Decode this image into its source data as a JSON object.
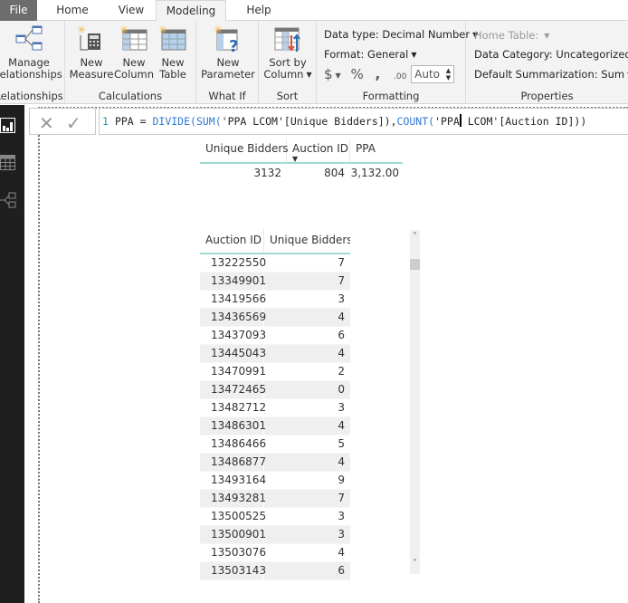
{
  "tabs": {
    "file": "File",
    "home": "Home",
    "view": "View",
    "modeling": "Modeling",
    "help": "Help"
  },
  "ribbon": {
    "relationships": {
      "manage_label_1": "Manage",
      "manage_label_2": "relationships",
      "group_label": "Relationships"
    },
    "calculations": {
      "new_measure_1": "New",
      "new_measure_2": "Measure",
      "new_column_1": "New",
      "new_column_2": "Column",
      "new_table_1": "New",
      "new_table_2": "Table",
      "group_label": "Calculations"
    },
    "whatif": {
      "new_parameter_1": "New",
      "new_parameter_2": "Parameter",
      "group_label": "What If"
    },
    "sort": {
      "sort_by_1": "Sort by",
      "sort_by_2": "Column",
      "group_label": "Sort"
    },
    "formatting": {
      "data_type": "Data type: Decimal Number",
      "format": "Format: General",
      "currency_symbol": "$",
      "percent_symbol": "%",
      "comma_symbol": ",",
      "decimal_symbol": ".00",
      "decimal_places": "Auto",
      "group_label": "Formatting"
    },
    "properties": {
      "home_table": "Home Table:",
      "data_category": "Data Category: Uncategorized",
      "default_summarization": "Default Summarization: Sum",
      "group_label": "Properties"
    }
  },
  "formula_bar": {
    "line_number": "1",
    "part1": "PPA = ",
    "fn_divide": "DIVIDE(",
    "fn_sum": "SUM(",
    "part2": "'PPA LCOM'[Unique Bidders]),",
    "fn_count": "COUNT(",
    "part3": "'PPA",
    "part4": " LCOM'[Auction ID]))"
  },
  "summary_table": {
    "headers": [
      "Unique Bidders",
      "Auction ID",
      "PPA"
    ],
    "row": [
      "3132",
      "804",
      "3,132.00"
    ]
  },
  "detail_table": {
    "headers": [
      "Auction ID",
      "Unique Bidders"
    ],
    "rows": [
      [
        "13222550",
        "7"
      ],
      [
        "13349901",
        "7"
      ],
      [
        "13419566",
        "3"
      ],
      [
        "13436569",
        "4"
      ],
      [
        "13437093",
        "6"
      ],
      [
        "13445043",
        "4"
      ],
      [
        "13470991",
        "2"
      ],
      [
        "13472465",
        "0"
      ],
      [
        "13482712",
        "3"
      ],
      [
        "13486301",
        "4"
      ],
      [
        "13486466",
        "5"
      ],
      [
        "13486877",
        "4"
      ],
      [
        "13493164",
        "9"
      ],
      [
        "13493281",
        "7"
      ],
      [
        "13500525",
        "3"
      ],
      [
        "13500901",
        "3"
      ],
      [
        "13503076",
        "4"
      ],
      [
        "13503143",
        "6"
      ]
    ]
  },
  "icons": {
    "cancel": "✕",
    "commit": "✓",
    "scroll_up": "˄",
    "scroll_down": "˅"
  }
}
